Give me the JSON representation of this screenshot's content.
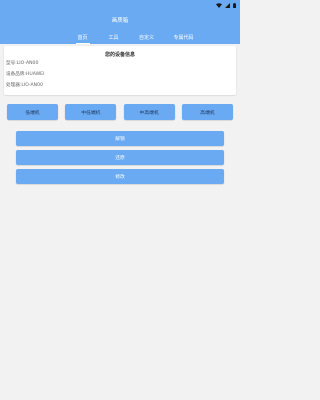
{
  "status_bar": {
    "icons": [
      "wifi-icon",
      "signal-icon",
      "battery-icon"
    ]
  },
  "app": {
    "title": "画质箱"
  },
  "tabs": [
    {
      "label": "首页",
      "active": true
    },
    {
      "label": "工具",
      "active": false
    },
    {
      "label": "自定义",
      "active": false
    },
    {
      "label": "专属代码",
      "active": false
    }
  ],
  "device_card": {
    "title": "您的设备信息",
    "lines": [
      "型号:LIO-AN00",
      "设备品牌:HUAWEI",
      "处理器:LIO-AN00"
    ]
  },
  "modes": [
    "低端机",
    "中低端机",
    "中高端机",
    "高端机"
  ],
  "actions": [
    "解锁",
    "还原",
    "修改"
  ],
  "colors": {
    "accent": "#6aaaf2",
    "background": "#f2f2f2",
    "card": "#ffffff"
  }
}
